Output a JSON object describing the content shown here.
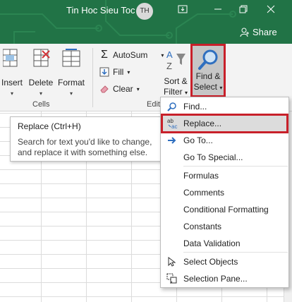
{
  "titlebar": {
    "title": "Tin Hoc Sieu Toc",
    "avatar_initials": "TH",
    "share_label": "Share"
  },
  "ribbon": {
    "cells_group": {
      "label": "Cells",
      "insert": "Insert",
      "delete": "Delete",
      "format": "Format"
    },
    "editing_group": {
      "label_partial": "Edit",
      "autosum": "AutoSum",
      "fill": "Fill",
      "clear": "Clear",
      "sort_filter_line1": "Sort &",
      "sort_filter_line2": "Filter",
      "find_select_line1": "Find &",
      "find_select_line2": "Select"
    }
  },
  "tooltip": {
    "title": "Replace (Ctrl+H)",
    "body_line1": "Search for text you'd like to change,",
    "body_line2": "and replace it with something else."
  },
  "menu": {
    "items": [
      {
        "label": "Find...",
        "icon": "search-icon"
      },
      {
        "label": "Replace...",
        "icon": "replace-icon"
      },
      {
        "label": "Go To...",
        "icon": "arrow-right-icon"
      },
      {
        "label": "Go To Special...",
        "icon": ""
      },
      {
        "label": "Formulas",
        "icon": ""
      },
      {
        "label": "Comments",
        "icon": ""
      },
      {
        "label": "Conditional Formatting",
        "icon": ""
      },
      {
        "label": "Constants",
        "icon": ""
      },
      {
        "label": "Data Validation",
        "icon": ""
      },
      {
        "label": "Select Objects",
        "icon": "pointer-icon"
      },
      {
        "label": "Selection Pane...",
        "icon": "selection-pane-icon"
      }
    ]
  },
  "colors": {
    "titlebar": "#217346",
    "highlight_border": "#c8202a",
    "accent_blue": "#2f6fbf"
  }
}
